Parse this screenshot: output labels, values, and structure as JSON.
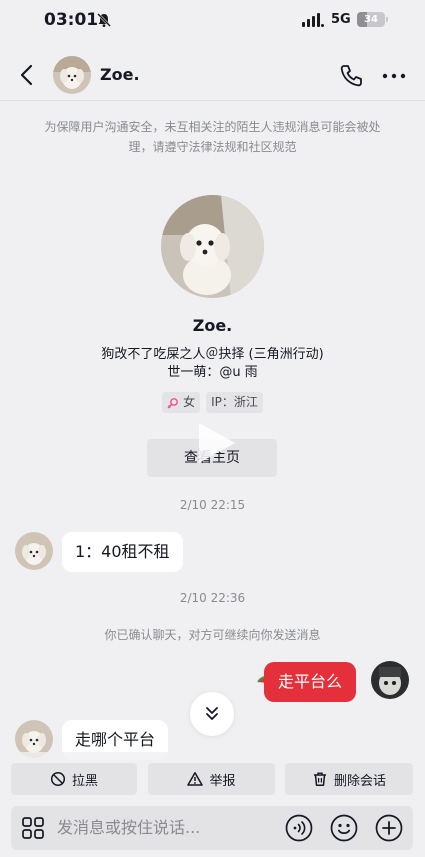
{
  "status_bar": {
    "time": "03:01",
    "network": "5G",
    "battery": "34",
    "battery_level": 0.34
  },
  "header": {
    "title": "Zoe."
  },
  "notice": "为保障用户沟通安全，未互相关注的陌生人违规消息可能会被处理，请遵守法律法规和社区规范",
  "profile": {
    "name": "Zoe.",
    "bio_line1": "狗改不了吃屎之人＠抉择 (三角洲行动)",
    "bio_line2": "世一萌：@u 雨",
    "gender_tag": "女",
    "ip_tag": "IP：浙江",
    "view_button": "查看主页"
  },
  "messages": {
    "time1": "2/10 22:15",
    "msg1": "1：40租不租",
    "time2": "2/10 22:36",
    "system": "你已确认聊天，对方可继续向你发送消息",
    "msg_out": "走平台么",
    "msg2": "走哪个平台"
  },
  "actions": {
    "block": "拉黑",
    "report": "举报",
    "delete": "删除会话"
  },
  "input": {
    "placeholder": "发消息或按住说话..."
  },
  "colors": {
    "accent": "#e4303a",
    "background": "#f0f0f2"
  }
}
